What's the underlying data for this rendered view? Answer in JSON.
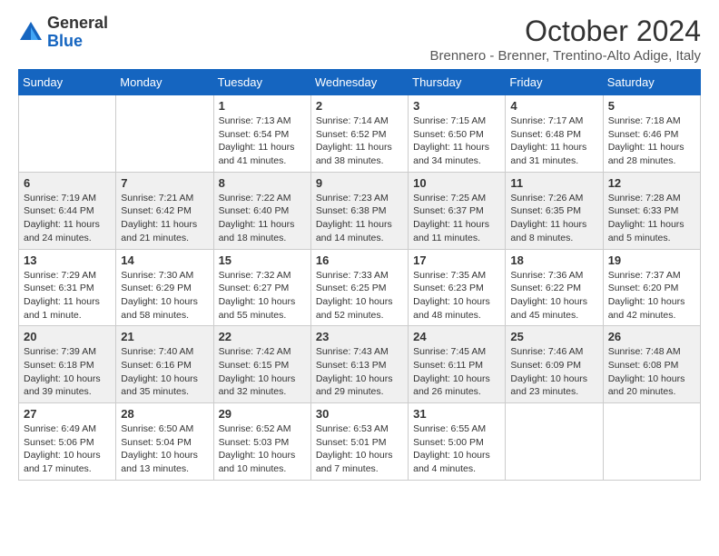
{
  "header": {
    "logo": {
      "text_general": "General",
      "text_blue": "Blue"
    },
    "month_title": "October 2024",
    "subtitle": "Brennero - Brenner, Trentino-Alto Adige, Italy"
  },
  "days_of_week": [
    "Sunday",
    "Monday",
    "Tuesday",
    "Wednesday",
    "Thursday",
    "Friday",
    "Saturday"
  ],
  "weeks": [
    {
      "days": [
        {
          "day": "",
          "info": ""
        },
        {
          "day": "",
          "info": ""
        },
        {
          "day": "1",
          "info": "Sunrise: 7:13 AM\nSunset: 6:54 PM\nDaylight: 11 hours and 41 minutes."
        },
        {
          "day": "2",
          "info": "Sunrise: 7:14 AM\nSunset: 6:52 PM\nDaylight: 11 hours and 38 minutes."
        },
        {
          "day": "3",
          "info": "Sunrise: 7:15 AM\nSunset: 6:50 PM\nDaylight: 11 hours and 34 minutes."
        },
        {
          "day": "4",
          "info": "Sunrise: 7:17 AM\nSunset: 6:48 PM\nDaylight: 11 hours and 31 minutes."
        },
        {
          "day": "5",
          "info": "Sunrise: 7:18 AM\nSunset: 6:46 PM\nDaylight: 11 hours and 28 minutes."
        }
      ]
    },
    {
      "days": [
        {
          "day": "6",
          "info": "Sunrise: 7:19 AM\nSunset: 6:44 PM\nDaylight: 11 hours and 24 minutes."
        },
        {
          "day": "7",
          "info": "Sunrise: 7:21 AM\nSunset: 6:42 PM\nDaylight: 11 hours and 21 minutes."
        },
        {
          "day": "8",
          "info": "Sunrise: 7:22 AM\nSunset: 6:40 PM\nDaylight: 11 hours and 18 minutes."
        },
        {
          "day": "9",
          "info": "Sunrise: 7:23 AM\nSunset: 6:38 PM\nDaylight: 11 hours and 14 minutes."
        },
        {
          "day": "10",
          "info": "Sunrise: 7:25 AM\nSunset: 6:37 PM\nDaylight: 11 hours and 11 minutes."
        },
        {
          "day": "11",
          "info": "Sunrise: 7:26 AM\nSunset: 6:35 PM\nDaylight: 11 hours and 8 minutes."
        },
        {
          "day": "12",
          "info": "Sunrise: 7:28 AM\nSunset: 6:33 PM\nDaylight: 11 hours and 5 minutes."
        }
      ]
    },
    {
      "days": [
        {
          "day": "13",
          "info": "Sunrise: 7:29 AM\nSunset: 6:31 PM\nDaylight: 11 hours and 1 minute."
        },
        {
          "day": "14",
          "info": "Sunrise: 7:30 AM\nSunset: 6:29 PM\nDaylight: 10 hours and 58 minutes."
        },
        {
          "day": "15",
          "info": "Sunrise: 7:32 AM\nSunset: 6:27 PM\nDaylight: 10 hours and 55 minutes."
        },
        {
          "day": "16",
          "info": "Sunrise: 7:33 AM\nSunset: 6:25 PM\nDaylight: 10 hours and 52 minutes."
        },
        {
          "day": "17",
          "info": "Sunrise: 7:35 AM\nSunset: 6:23 PM\nDaylight: 10 hours and 48 minutes."
        },
        {
          "day": "18",
          "info": "Sunrise: 7:36 AM\nSunset: 6:22 PM\nDaylight: 10 hours and 45 minutes."
        },
        {
          "day": "19",
          "info": "Sunrise: 7:37 AM\nSunset: 6:20 PM\nDaylight: 10 hours and 42 minutes."
        }
      ]
    },
    {
      "days": [
        {
          "day": "20",
          "info": "Sunrise: 7:39 AM\nSunset: 6:18 PM\nDaylight: 10 hours and 39 minutes."
        },
        {
          "day": "21",
          "info": "Sunrise: 7:40 AM\nSunset: 6:16 PM\nDaylight: 10 hours and 35 minutes."
        },
        {
          "day": "22",
          "info": "Sunrise: 7:42 AM\nSunset: 6:15 PM\nDaylight: 10 hours and 32 minutes."
        },
        {
          "day": "23",
          "info": "Sunrise: 7:43 AM\nSunset: 6:13 PM\nDaylight: 10 hours and 29 minutes."
        },
        {
          "day": "24",
          "info": "Sunrise: 7:45 AM\nSunset: 6:11 PM\nDaylight: 10 hours and 26 minutes."
        },
        {
          "day": "25",
          "info": "Sunrise: 7:46 AM\nSunset: 6:09 PM\nDaylight: 10 hours and 23 minutes."
        },
        {
          "day": "26",
          "info": "Sunrise: 7:48 AM\nSunset: 6:08 PM\nDaylight: 10 hours and 20 minutes."
        }
      ]
    },
    {
      "days": [
        {
          "day": "27",
          "info": "Sunrise: 6:49 AM\nSunset: 5:06 PM\nDaylight: 10 hours and 17 minutes."
        },
        {
          "day": "28",
          "info": "Sunrise: 6:50 AM\nSunset: 5:04 PM\nDaylight: 10 hours and 13 minutes."
        },
        {
          "day": "29",
          "info": "Sunrise: 6:52 AM\nSunset: 5:03 PM\nDaylight: 10 hours and 10 minutes."
        },
        {
          "day": "30",
          "info": "Sunrise: 6:53 AM\nSunset: 5:01 PM\nDaylight: 10 hours and 7 minutes."
        },
        {
          "day": "31",
          "info": "Sunrise: 6:55 AM\nSunset: 5:00 PM\nDaylight: 10 hours and 4 minutes."
        },
        {
          "day": "",
          "info": ""
        },
        {
          "day": "",
          "info": ""
        }
      ]
    }
  ]
}
